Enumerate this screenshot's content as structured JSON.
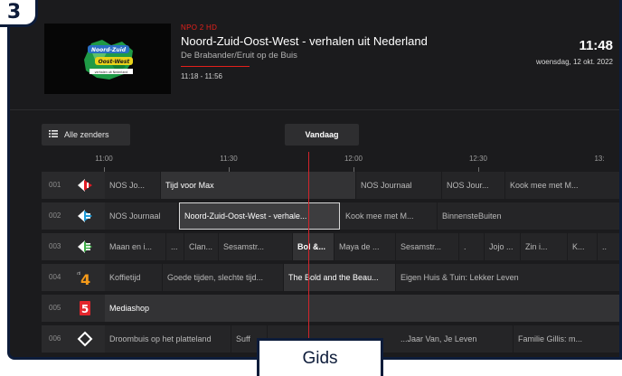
{
  "step_badge": "3",
  "header": {
    "channel_tag": "NPO 2 HD",
    "title": "Noord-Zuid-Oost-West - verhalen uit Nederland",
    "subtitle": "De Brabander/Eruit op de Buis",
    "time_range": "11:18 - 11:56",
    "clock": "11:48",
    "date": "woensdag, 12 okt. 2022",
    "thumbnail": {
      "line1": "Noord-Zuid",
      "line2": "Oost-West",
      "line3": "verhalen uit Nederland"
    }
  },
  "controls": {
    "channels_label": "Alle zenders",
    "today_label": "Vandaag"
  },
  "timeline": {
    "ticks": [
      "11:00",
      "11:30",
      "12:00",
      "12:30",
      "13:"
    ]
  },
  "channels": [
    {
      "number": "001",
      "logo": "npo1-logo-icon",
      "programs": [
        {
          "title": "NOS Jo...",
          "state": "past"
        },
        {
          "title": "Tijd voor Max",
          "state": "current"
        },
        {
          "title": "NOS Journaal",
          "state": "future"
        },
        {
          "title": "NOS Jour...",
          "state": "future"
        },
        {
          "title": "Kook mee met M...",
          "state": "future"
        }
      ]
    },
    {
      "number": "002",
      "logo": "npo2-logo-icon",
      "programs": [
        {
          "title": "NOS Journaal",
          "state": "past"
        },
        {
          "title": "Noord-Zuid-Oost-West - verhale...",
          "state": "selected"
        },
        {
          "title": "Kook mee met M...",
          "state": "future"
        },
        {
          "title": "BinnensteBuiten",
          "state": "future"
        }
      ]
    },
    {
      "number": "003",
      "logo": "npo3-logo-icon",
      "programs": [
        {
          "title": "Maan en i...",
          "state": "past"
        },
        {
          "title": "...",
          "state": "past"
        },
        {
          "title": "Clan...",
          "state": "past"
        },
        {
          "title": "Sesamstr...",
          "state": "past"
        },
        {
          "title": "Bol &...",
          "state": "current"
        },
        {
          "title": "Maya de ...",
          "state": "future"
        },
        {
          "title": "Sesamstr...",
          "state": "future"
        },
        {
          "title": ".",
          "state": "future"
        },
        {
          "title": "Jojo ...",
          "state": "future"
        },
        {
          "title": "Zin i...",
          "state": "future"
        },
        {
          "title": "K...",
          "state": "future"
        },
        {
          "title": "..",
          "state": "future"
        }
      ]
    },
    {
      "number": "004",
      "logo": "rtl4-logo-icon",
      "programs": [
        {
          "title": "Koffietijd",
          "state": "past"
        },
        {
          "title": "Goede tijden, slechte tijd...",
          "state": "past"
        },
        {
          "title": "The Bold and the Beau...",
          "state": "current"
        },
        {
          "title": "Eigen Huis & Tuin: Lekker Leven",
          "state": "future"
        }
      ]
    },
    {
      "number": "005",
      "logo": "rtl5-logo-icon",
      "programs": [
        {
          "title": "Mediashop",
          "state": "current"
        }
      ]
    },
    {
      "number": "006",
      "logo": "sbs6-logo-icon",
      "programs": [
        {
          "title": "Droombuis op het platteland",
          "state": "past"
        },
        {
          "title": "Suff",
          "state": "past"
        },
        {
          "title": "...Jaar Van, Je Leven",
          "state": "future"
        },
        {
          "title": "Familie Gillis: m...",
          "state": "future"
        }
      ]
    }
  ],
  "footer_tab": "Gids"
}
